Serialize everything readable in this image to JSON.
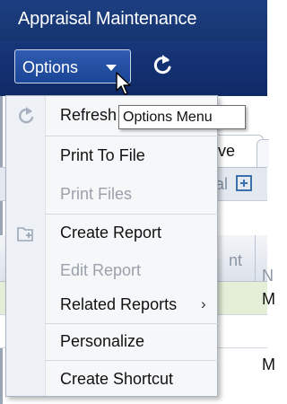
{
  "window": {
    "title": "Appraisal Maintenance"
  },
  "toolbar": {
    "options_label": "Options",
    "refresh_icon": "refresh-icon"
  },
  "tooltip": {
    "text": "Options Menu"
  },
  "menu": {
    "items": [
      {
        "label": "Refresh",
        "icon": "refresh-icon",
        "enabled": true
      },
      {
        "label": "Print To File",
        "enabled": true
      },
      {
        "label": "Print Files",
        "enabled": false
      },
      {
        "label": "Create Report",
        "icon": "create-report-icon",
        "enabled": true
      },
      {
        "label": "Edit Report",
        "enabled": false
      },
      {
        "label": "Related Reports",
        "submenu": true,
        "submenu_indicator": "›",
        "enabled": true
      },
      {
        "label": "Personalize",
        "enabled": true
      },
      {
        "label": "Create Shortcut",
        "enabled": true
      }
    ]
  },
  "background": {
    "tab_fragment": "ve",
    "toolbar_fragment": "al",
    "header_fragment_1": "nt",
    "header_fragment_2": "N",
    "row_fragments": [
      "M",
      "M"
    ]
  },
  "colors": {
    "titlebar": "#1d3f82",
    "toolbar": "#17367a",
    "options_button": "#2f5cb0",
    "menu_background": "#f6f7f9",
    "disabled_text": "#9aa1ab",
    "highlight_row": "#e5efd8"
  }
}
